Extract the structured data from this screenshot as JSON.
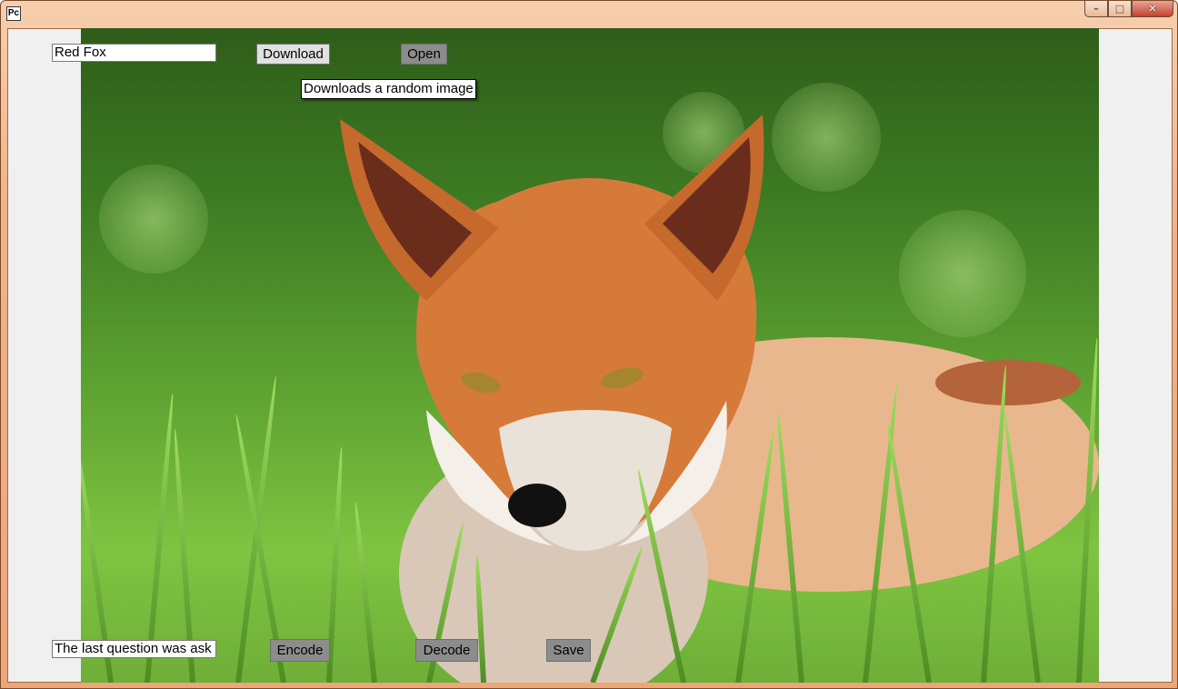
{
  "window": {
    "icon_text": "Pc",
    "caption_buttons": {
      "minimize": "–",
      "maximize": "□",
      "close": "✕"
    }
  },
  "top_bar": {
    "search_value": "Red Fox",
    "download_label": "Download",
    "open_label": "Open",
    "tooltip": "Downloads a random image"
  },
  "bottom_bar": {
    "message_value": "The last question was ask",
    "encode_label": "Encode",
    "decode_label": "Decode",
    "save_label": "Save"
  },
  "image": {
    "subject": "red fox lying in grass"
  },
  "colors": {
    "title_bar": "#f0b48a",
    "client_bg": "#f0f0f0",
    "button_light": "#e1e1e1",
    "button_dark": "#8c8c8c",
    "close_button": "#c2432e"
  }
}
